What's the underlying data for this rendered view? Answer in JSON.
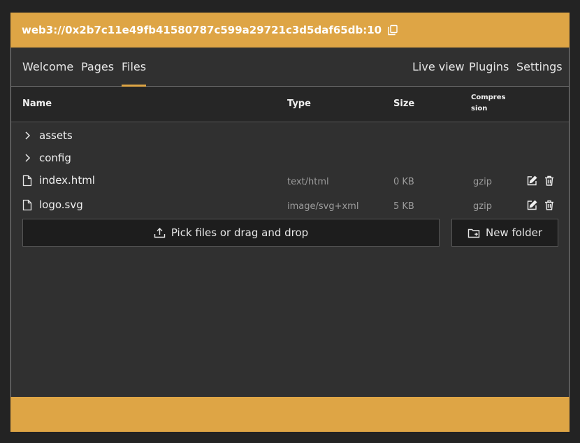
{
  "header": {
    "address": "web3://0x2b7c11e49fb41580787c599a29721c3d5daf65db:10"
  },
  "tabs_left": [
    {
      "label": "Welcome",
      "active": false
    },
    {
      "label": "Pages",
      "active": false
    },
    {
      "label": "Files",
      "active": true
    }
  ],
  "tabs_right": [
    {
      "label": "Live view"
    },
    {
      "label": "Plugins"
    },
    {
      "label": "Settings"
    }
  ],
  "table": {
    "headers": {
      "name": "Name",
      "type": "Type",
      "size": "Size",
      "compression": "Compression"
    },
    "folders": [
      {
        "name": "assets"
      },
      {
        "name": "config"
      }
    ],
    "files": [
      {
        "name": "index.html",
        "type": "text/html",
        "size": "0 KB",
        "compression": "gzip"
      },
      {
        "name": "logo.svg",
        "type": "image/svg+xml",
        "size": "5 KB",
        "compression": "gzip"
      }
    ]
  },
  "actions": {
    "upload_label": "Pick files or drag and drop",
    "new_folder_label": "New folder"
  },
  "colors": {
    "accent": "#dea545",
    "background": "#303030",
    "table_header": "#262626"
  },
  "icons": [
    "copy-icon",
    "chevron-right-icon",
    "file-icon",
    "edit-icon",
    "trash-icon",
    "upload-icon",
    "folder-plus-icon"
  ]
}
